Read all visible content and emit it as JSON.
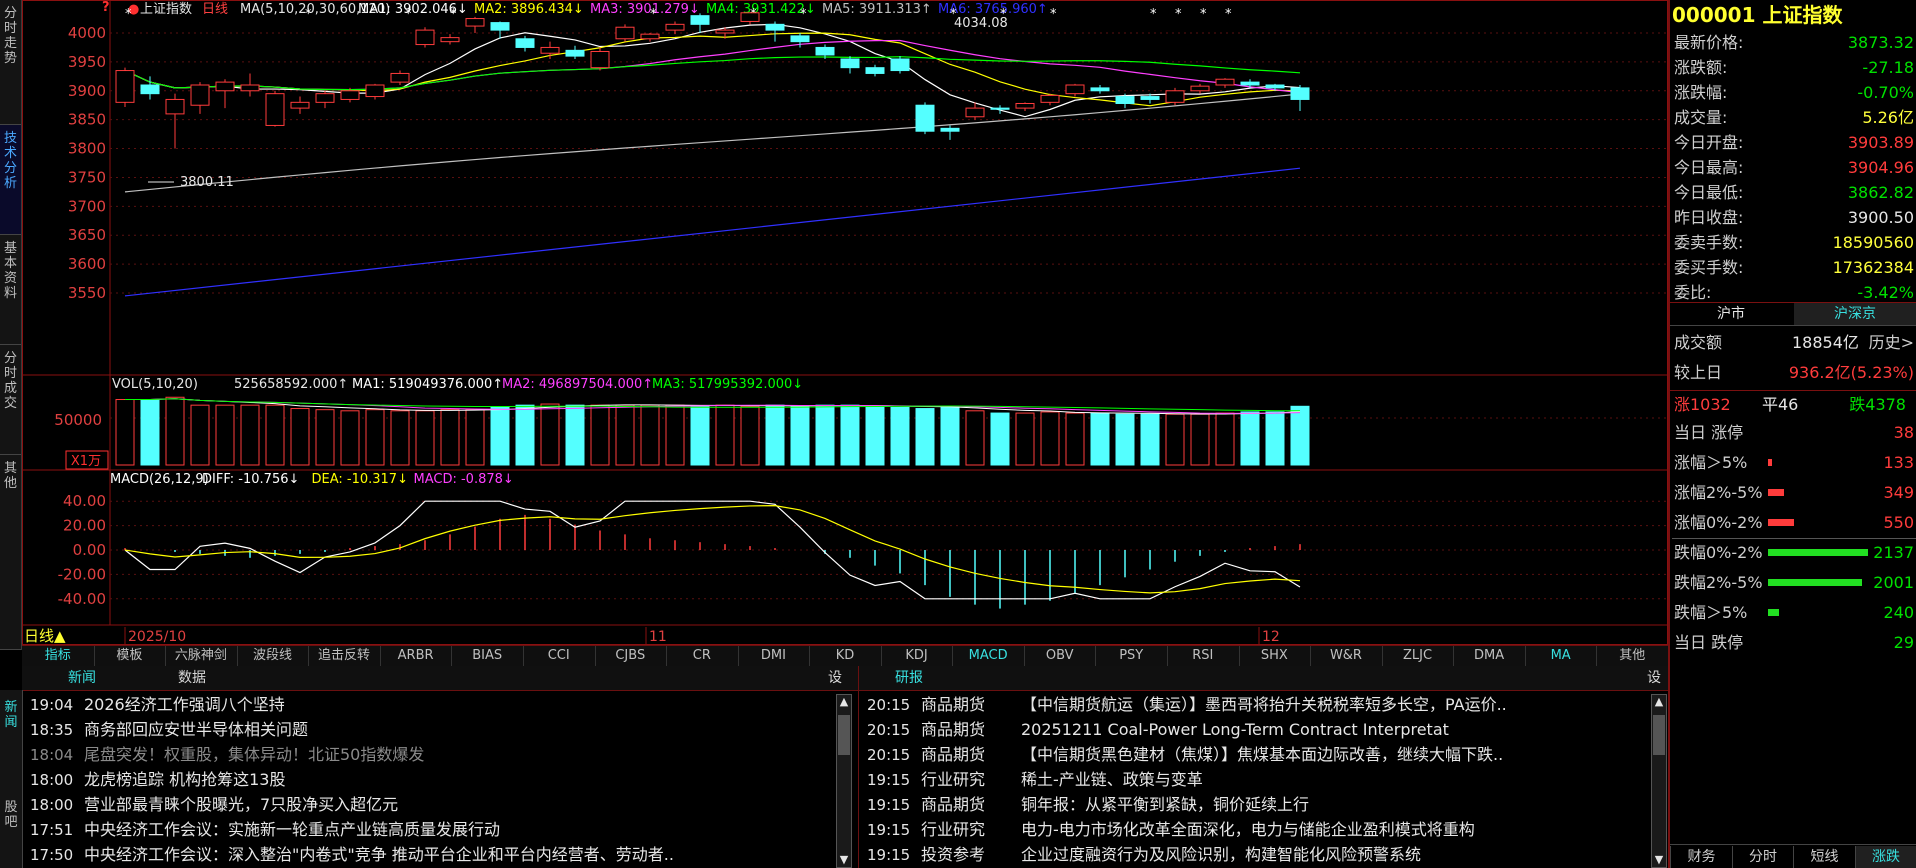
{
  "left_tabs": [
    {
      "label": "分时走势"
    },
    {
      "label": "技术分析"
    },
    {
      "label": "基本资料"
    },
    {
      "label": "分时成交"
    },
    {
      "label": "其他"
    }
  ],
  "chart_header": {
    "name": "上证指数",
    "period": "日线",
    "ma_def": "MA(5,10,20,30,60,120)",
    "ma": [
      {
        "label": "MA1:",
        "value": "3902.046↓",
        "color": "#ffffff"
      },
      {
        "label": "MA2:",
        "value": "3896.434↓",
        "color": "#ffff00"
      },
      {
        "label": "MA3:",
        "value": "3901.279↓",
        "color": "#ff40ff"
      },
      {
        "label": "MA4:",
        "value": "3931.422↓",
        "color": "#00ff00"
      },
      {
        "label": "MA5:",
        "value": "3911.313↑",
        "color": "#c0c0c0"
      },
      {
        "label": "MA6:",
        "value": "3765.960↑",
        "color": "#3030ff"
      }
    ]
  },
  "price_axis": [
    "4000",
    "3950",
    "3900",
    "3850",
    "3800",
    "3750",
    "3700",
    "3650",
    "3600",
    "3550"
  ],
  "price_annotations": {
    "high": "4034.08",
    "low": "3800.11"
  },
  "vol_header": {
    "def": "VOL(5,10,20)",
    "value": "525658592.000↑",
    "ma": [
      {
        "label": "MA1:",
        "value": "519049376.000↑",
        "color": "#ffffff"
      },
      {
        "label": "MA2:",
        "value": "496897504.000↑",
        "color": "#ff40ff"
      },
      {
        "label": "MA3:",
        "value": "517995392.000↓",
        "color": "#00ff00"
      }
    ]
  },
  "vol_axis": [
    "50000"
  ],
  "vol_unit": "X1万",
  "macd_header": {
    "def": "MACD(26,12,9)",
    "items": [
      {
        "label": "DIFF:",
        "value": "-10.756↓",
        "color": "#ffffff"
      },
      {
        "label": "DEA:",
        "value": "-10.317↓",
        "color": "#ffff00"
      },
      {
        "label": "MACD:",
        "value": "-0.878↓",
        "color": "#ff40ff"
      }
    ]
  },
  "macd_axis": [
    "40.00",
    "20.00",
    "0.00",
    "-20.00",
    "-40.00"
  ],
  "date_axis": {
    "period_label": "日线▲",
    "labels": [
      "2025/10",
      "11",
      "12"
    ]
  },
  "candles": [
    [
      3880,
      3935,
      3872,
      3940
    ],
    [
      3910,
      3895,
      3885,
      3925
    ],
    [
      3860,
      3885,
      3800,
      3895
    ],
    [
      3875,
      3910,
      3860,
      3915
    ],
    [
      3900,
      3915,
      3870,
      3920
    ],
    [
      3900,
      3910,
      3890,
      3930
    ],
    [
      3840,
      3895,
      3838,
      3900
    ],
    [
      3870,
      3880,
      3860,
      3890
    ],
    [
      3880,
      3895,
      3870,
      3900
    ],
    [
      3885,
      3900,
      3880,
      3905
    ],
    [
      3890,
      3910,
      3885,
      3912
    ],
    [
      3915,
      3930,
      3910,
      3935
    ],
    [
      3980,
      4005,
      3975,
      4010
    ],
    [
      3985,
      3992,
      3980,
      3998
    ],
    [
      4012,
      4025,
      4000,
      4028
    ],
    [
      4018,
      4005,
      3990,
      4020
    ],
    [
      3990,
      3975,
      3968,
      3995
    ],
    [
      3965,
      3975,
      3955,
      3985
    ],
    [
      3970,
      3960,
      3955,
      3978
    ],
    [
      3940,
      3968,
      3935,
      3975
    ],
    [
      3990,
      4010,
      3985,
      4015
    ],
    [
      3990,
      3998,
      3985,
      4000
    ],
    [
      4005,
      4015,
      3998,
      4020
    ],
    [
      4030,
      4015,
      4000,
      4034
    ],
    [
      4000,
      4005,
      3990,
      4010
    ],
    [
      4020,
      4035,
      4015,
      4035
    ],
    [
      4015,
      4005,
      3985,
      4020
    ],
    [
      3995,
      3985,
      3975,
      4000
    ],
    [
      3975,
      3962,
      3955,
      3980
    ],
    [
      3955,
      3940,
      3930,
      3960
    ],
    [
      3940,
      3930,
      3925,
      3945
    ],
    [
      3955,
      3935,
      3930,
      3960
    ],
    [
      3875,
      3830,
      3825,
      3880
    ],
    [
      3835,
      3830,
      3815,
      3840
    ],
    [
      3855,
      3870,
      3850,
      3880
    ],
    [
      3870,
      3868,
      3860,
      3875
    ],
    [
      3870,
      3878,
      3865,
      3880
    ],
    [
      3880,
      3892,
      3875,
      3895
    ],
    [
      3895,
      3910,
      3890,
      3912
    ],
    [
      3905,
      3900,
      3895,
      3910
    ],
    [
      3890,
      3878,
      3870,
      3895
    ],
    [
      3890,
      3885,
      3878,
      3895
    ],
    [
      3880,
      3900,
      3875,
      3905
    ],
    [
      3900,
      3908,
      3895,
      3912
    ],
    [
      3910,
      3920,
      3905,
      3922
    ],
    [
      3915,
      3910,
      3905,
      3920
    ],
    [
      3910,
      3905,
      3900,
      3912
    ],
    [
      3905,
      3885,
      3865,
      3910
    ]
  ],
  "volumes": [
    58000,
    58000,
    60000,
    53000,
    53000,
    53000,
    53000,
    50000,
    49000,
    48000,
    49000,
    48000,
    48000,
    49000,
    49000,
    51000,
    53000,
    54000,
    53000,
    53000,
    53000,
    53000,
    53000,
    52000,
    53000,
    52000,
    53000,
    52000,
    53000,
    53000,
    52000,
    51000,
    50000,
    52000,
    48000,
    46000,
    46000,
    47000,
    46000,
    46000,
    45000,
    45000,
    45000,
    45000,
    46000,
    47000,
    47000,
    52000
  ],
  "macd_bars": [
    1,
    0,
    -1,
    -2,
    -3,
    -4,
    -3,
    -2,
    -1,
    1,
    2,
    3,
    5,
    8,
    12,
    16,
    18,
    16,
    13,
    10,
    8,
    6,
    5,
    4,
    3,
    2,
    1,
    0,
    -2,
    -4,
    -8,
    -12,
    -18,
    -24,
    -28,
    -30,
    -28,
    -26,
    -22,
    -18,
    -14,
    -10,
    -6,
    -3,
    -1,
    1,
    2,
    3
  ],
  "right_panel": {
    "code": "000001",
    "name": "上证指数",
    "quote": [
      {
        "label": "最新价格:",
        "value": "3873.32",
        "color": "green"
      },
      {
        "label": "涨跌额:",
        "value": "-27.18",
        "color": "green"
      },
      {
        "label": "涨跌幅:",
        "value": "-0.70%",
        "color": "green"
      },
      {
        "label": "成交量:",
        "value": "5.26亿",
        "color": "yellow"
      },
      {
        "label": "今日开盘:",
        "value": "3903.89",
        "color": "red"
      },
      {
        "label": "今日最高:",
        "value": "3904.96",
        "color": "red"
      },
      {
        "label": "今日最低:",
        "value": "3862.82",
        "color": "green"
      },
      {
        "label": "昨日收盘:",
        "value": "3900.50",
        "color": "white"
      },
      {
        "label": "委卖手数:",
        "value": "18590560",
        "color": "yellow"
      },
      {
        "label": "委买手数:",
        "value": "17362384",
        "color": "yellow"
      },
      {
        "label": "委比:",
        "value": "-3.42%",
        "color": "green"
      }
    ],
    "market_tabs": [
      {
        "label": "沪市"
      },
      {
        "label": "沪深京"
      }
    ],
    "turnover": {
      "label": "成交额",
      "value": "18854亿",
      "extra": "历史>"
    },
    "vs_prev": {
      "label": "较上日",
      "value": "936.2亿(5.23%)"
    },
    "breadth": {
      "up": "涨1032",
      "flat": "平46",
      "down": "跌4378"
    },
    "dist": [
      {
        "label": "当日 涨停",
        "value": "38",
        "bar": 0,
        "color": "red"
      },
      {
        "label": "涨幅＞5%",
        "value": "133",
        "bar": 0.04,
        "color": "red"
      },
      {
        "label": "涨幅2%-5%",
        "value": "349",
        "bar": 0.16,
        "color": "red"
      },
      {
        "label": "涨幅0%-2%",
        "value": "550",
        "bar": 0.26,
        "color": "red"
      },
      {
        "label": "跌幅0%-2%",
        "value": "2137",
        "bar": 1.0,
        "color": "green"
      },
      {
        "label": "跌幅2%-5%",
        "value": "2001",
        "bar": 0.94,
        "color": "green"
      },
      {
        "label": "跌幅＞5%",
        "value": "240",
        "bar": 0.11,
        "color": "green"
      },
      {
        "label": "当日 跌停",
        "value": "29",
        "bar": 0,
        "color": "green"
      }
    ],
    "bottom_tabs": [
      {
        "label": "财务"
      },
      {
        "label": "分时"
      },
      {
        "label": "短线"
      },
      {
        "label": "涨跌"
      }
    ]
  },
  "indicator_tabs": [
    "指标",
    "模板",
    "六脉神剑",
    "波段线",
    "追击反转",
    "ARBR",
    "BIAS",
    "CCI",
    "CJBS",
    "CR",
    "DMI",
    "KD",
    "KDJ",
    "MACD",
    "OBV",
    "PSY",
    "RSI",
    "SHX",
    "W&R",
    "ZLJC",
    "DMA",
    "MA",
    "其他"
  ],
  "news_panel": {
    "tabs": [
      "新闻",
      "数据"
    ],
    "settings": "设",
    "side_tabs": [
      "新闻",
      "股吧"
    ],
    "items": [
      {
        "time": "19:04",
        "title": "2026经济工作强调八个坚持",
        "dim": false
      },
      {
        "time": "18:35",
        "title": "商务部回应安世半导体相关问题",
        "dim": false
      },
      {
        "time": "18:04",
        "title": "尾盘突发！权重股，集体异动！北证50指数爆发",
        "dim": true
      },
      {
        "time": "18:00",
        "title": "龙虎榜追踪 机构抢筹这13股",
        "dim": false
      },
      {
        "time": "18:00",
        "title": "营业部最青睐个股曝光，7只股净买入超亿元",
        "dim": false
      },
      {
        "time": "17:51",
        "title": "中央经济工作会议：实施新一轮重点产业链高质量发展行动",
        "dim": false
      },
      {
        "time": "17:50",
        "title": "中央经济工作会议：深入整治\"内卷式\"竞争 推动平台企业和平台内经营者、劳动者..",
        "dim": false
      }
    ]
  },
  "research_panel": {
    "tab": "研报",
    "settings": "设",
    "items": [
      {
        "time": "20:15",
        "cat": "商品期货",
        "title": "【中信期货航运（集运）】墨西哥将抬升关税税率短多长空，PA运价.."
      },
      {
        "time": "20:15",
        "cat": "商品期货",
        "title": "20251211 Coal-Power Long-Term Contract Interpretat"
      },
      {
        "time": "20:15",
        "cat": "商品期货",
        "title": "【中信期货黑色建材（焦煤）】焦煤基本面边际改善，继续大幅下跌.."
      },
      {
        "time": "19:15",
        "cat": "行业研究",
        "title": "稀土-产业链、政策与变革"
      },
      {
        "time": "19:15",
        "cat": "商品期货",
        "title": "铜年报：从紧平衡到紧缺，铜价延续上行"
      },
      {
        "time": "19:15",
        "cat": "行业研究",
        "title": "电力-电力市场化改革全面深化，电力与储能企业盈利模式将重构"
      },
      {
        "time": "19:15",
        "cat": "投资参考",
        "title": "企业过度融资行为及风险识别，构建智能化风险预警系统"
      }
    ]
  }
}
